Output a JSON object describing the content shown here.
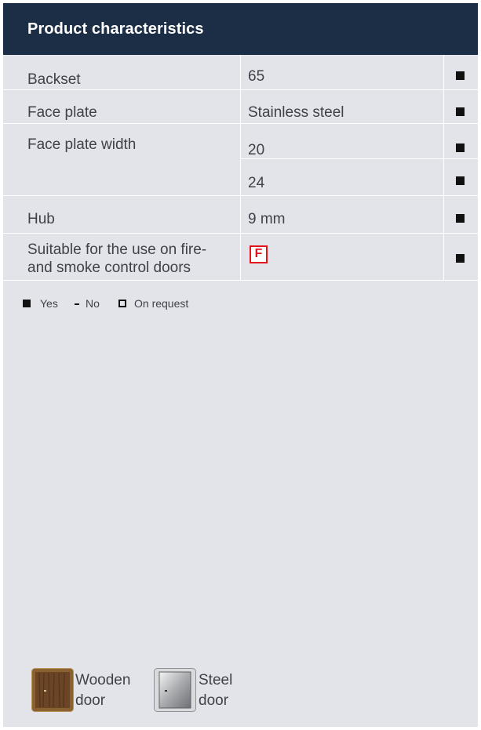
{
  "header": {
    "title": "Product characteristics"
  },
  "rows": [
    {
      "label": "Backset",
      "value": "65",
      "marker": "yes"
    },
    {
      "label": "Face plate",
      "value": "Stainless steel",
      "marker": "yes"
    },
    {
      "label": "Face plate width",
      "values": [
        "20",
        "24"
      ],
      "marker": "yes"
    },
    {
      "label": "Hub",
      "value": "9 mm",
      "marker": "yes"
    },
    {
      "label_lines": [
        "Suitable for the use on fire-",
        "and smoke control doors"
      ],
      "badge": "F",
      "marker": "yes"
    }
  ],
  "legend": {
    "yes": "Yes",
    "no": "No",
    "on_request": "On request"
  },
  "doors": {
    "wooden_line1": "Wooden",
    "wooden_line2": "door",
    "steel_line1": "Steel",
    "steel_line2": "door"
  },
  "colors": {
    "header_bg": "#1c2e45",
    "panel_bg": "#e2e4ea",
    "fire_badge": "#e3141b"
  }
}
